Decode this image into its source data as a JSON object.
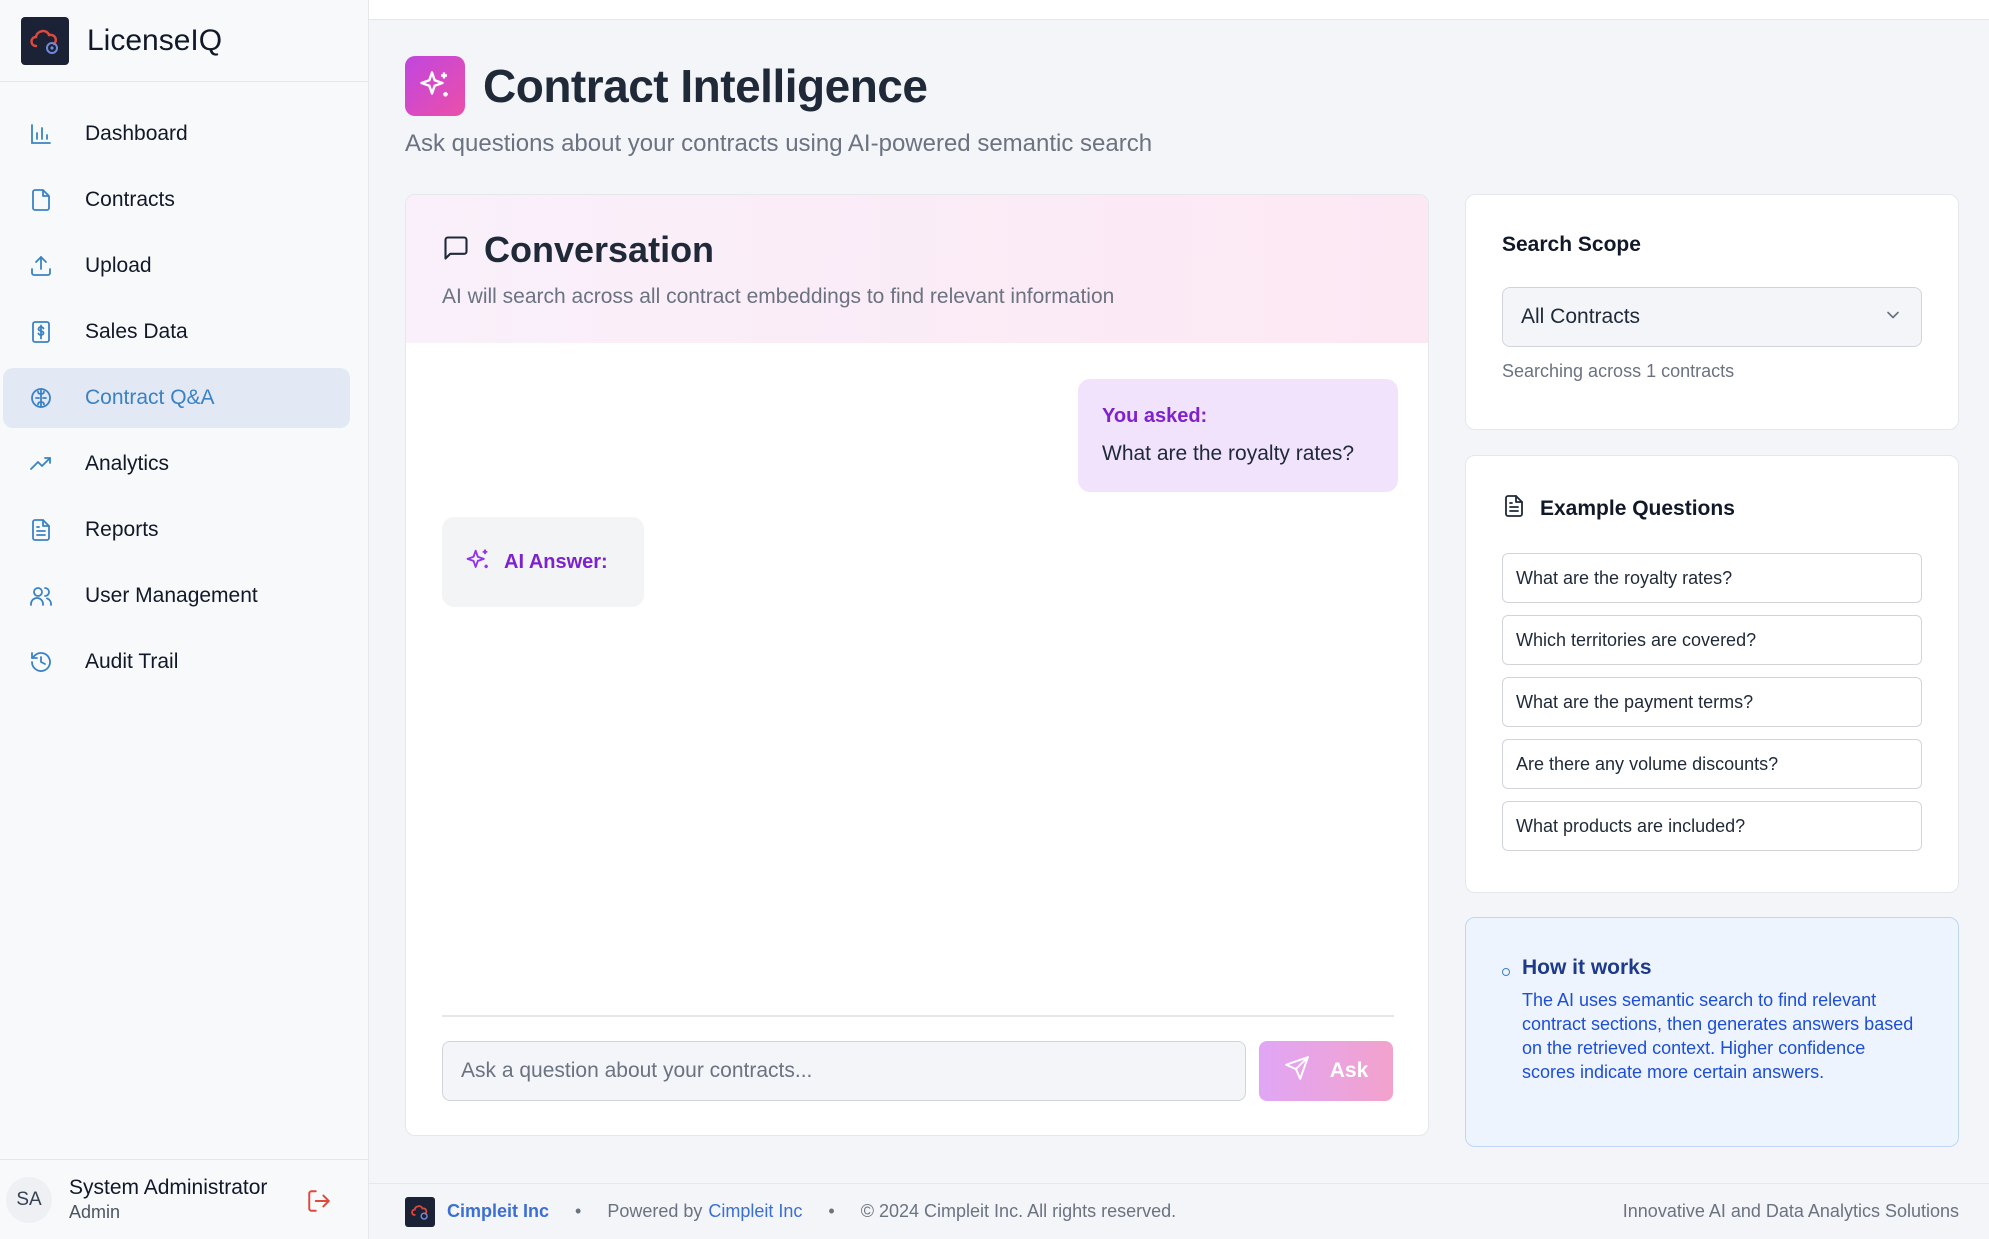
{
  "app": {
    "name": "LicenseIQ"
  },
  "sidebar": {
    "items": [
      {
        "label": "Dashboard",
        "icon": "bar-chart-icon",
        "active": false
      },
      {
        "label": "Contracts",
        "icon": "file-icon",
        "active": false
      },
      {
        "label": "Upload",
        "icon": "upload-icon",
        "active": false
      },
      {
        "label": "Sales Data",
        "icon": "receipt-dollar-icon",
        "active": false
      },
      {
        "label": "Contract Q&A",
        "icon": "brain-icon",
        "active": true
      },
      {
        "label": "Analytics",
        "icon": "trending-up-icon",
        "active": false
      },
      {
        "label": "Reports",
        "icon": "file-text-icon",
        "active": false
      },
      {
        "label": "User Management",
        "icon": "users-icon",
        "active": false
      },
      {
        "label": "Audit Trail",
        "icon": "history-icon",
        "active": false
      }
    ]
  },
  "user": {
    "initials": "SA",
    "name": "System Administrator",
    "role": "Admin"
  },
  "header": {
    "title": "Contract Intelligence",
    "subtitle": "Ask questions about your contracts using AI-powered semantic search"
  },
  "conversation": {
    "title": "Conversation",
    "description": "AI will search across all contract embeddings to find relevant information",
    "user_label": "You asked:",
    "user_question": "What are the royalty rates?",
    "ai_label": "AI Answer:",
    "input_placeholder": "Ask a question about your contracts...",
    "input_value": "",
    "ask_label": "Ask"
  },
  "scope": {
    "title": "Search Scope",
    "selected": "All Contracts",
    "hint": "Searching across 1 contracts"
  },
  "examples": {
    "title": "Example Questions",
    "questions": [
      "What are the royalty rates?",
      "Which territories are covered?",
      "What are the payment terms?",
      "Are there any volume discounts?",
      "What products are included?"
    ]
  },
  "how": {
    "title": "How it works",
    "text": "The AI uses semantic search to find relevant contract sections, then generates answers based on the retrieved context. Higher confidence scores indicate more certain answers."
  },
  "footer": {
    "company": "Cimpleit Inc",
    "powered_prefix": "Powered by",
    "powered_link": "Cimpleit Inc",
    "copyright": "© 2024 Cimpleit Inc. All rights reserved.",
    "tagline": "Innovative AI and Data Analytics Solutions"
  },
  "colors": {
    "accent": "#3b82c4",
    "purple": "#7e22ce",
    "ask_gradient_start": "#e0a6f5",
    "ask_gradient_end": "#f3a2cc",
    "active_nav_bg": "#e2e9f4"
  }
}
